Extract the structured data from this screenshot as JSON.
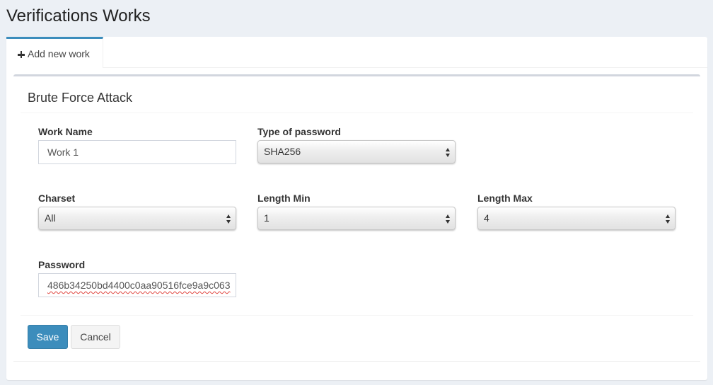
{
  "page": {
    "title": "Verifications Works"
  },
  "tabs": [
    {
      "label": "Add new work",
      "icon": "plus-icon",
      "active": true
    }
  ],
  "form": {
    "title": "Brute Force Attack",
    "work_name": {
      "label": "Work Name",
      "value": "Work 1"
    },
    "type_of_password": {
      "label": "Type of password",
      "value": "SHA256"
    },
    "charset": {
      "label": "Charset",
      "value": "All"
    },
    "length_min": {
      "label": "Length Min",
      "value": "1"
    },
    "length_max": {
      "label": "Length Max",
      "value": "4"
    },
    "password": {
      "label": "Password",
      "value": "486b34250bd4400c0aa90516fce9a9c063"
    }
  },
  "buttons": {
    "save": "Save",
    "cancel": "Cancel"
  },
  "colors": {
    "primary": "#3c8dbc",
    "background": "#ecf0f5",
    "tab_accent": "#3c8dbc"
  }
}
